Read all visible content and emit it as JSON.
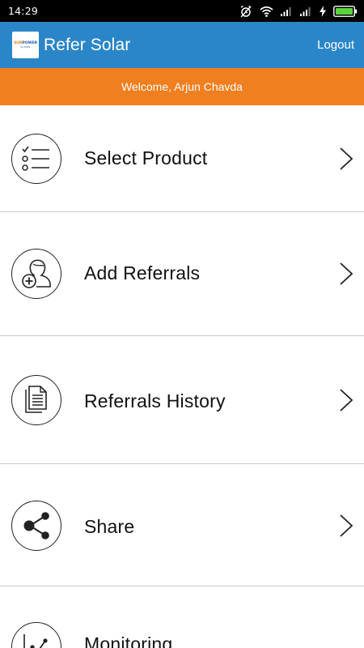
{
  "status_bar": {
    "time": "14:29"
  },
  "app_bar": {
    "logo": {
      "brand_a": "SUN",
      "brand_b": "POWER",
      "tagline": "by ESEL"
    },
    "title": "Refer Solar",
    "logout_label": "Logout"
  },
  "welcome_banner": {
    "text": "Welcome, Arjun Chavda"
  },
  "menu": {
    "items": [
      {
        "label": "Select Product",
        "icon": "checklist-icon"
      },
      {
        "label": "Add Referrals",
        "icon": "add-person-icon"
      },
      {
        "label": "Referrals History",
        "icon": "documents-icon"
      },
      {
        "label": "Share",
        "icon": "share-icon"
      },
      {
        "label": "Monitoring",
        "icon": "line-chart-icon"
      }
    ]
  },
  "colors": {
    "app_bar": "#2a86c8",
    "welcome_banner": "#f07f1f",
    "status_bar": "#000000",
    "divider": "#c9c9c9"
  }
}
